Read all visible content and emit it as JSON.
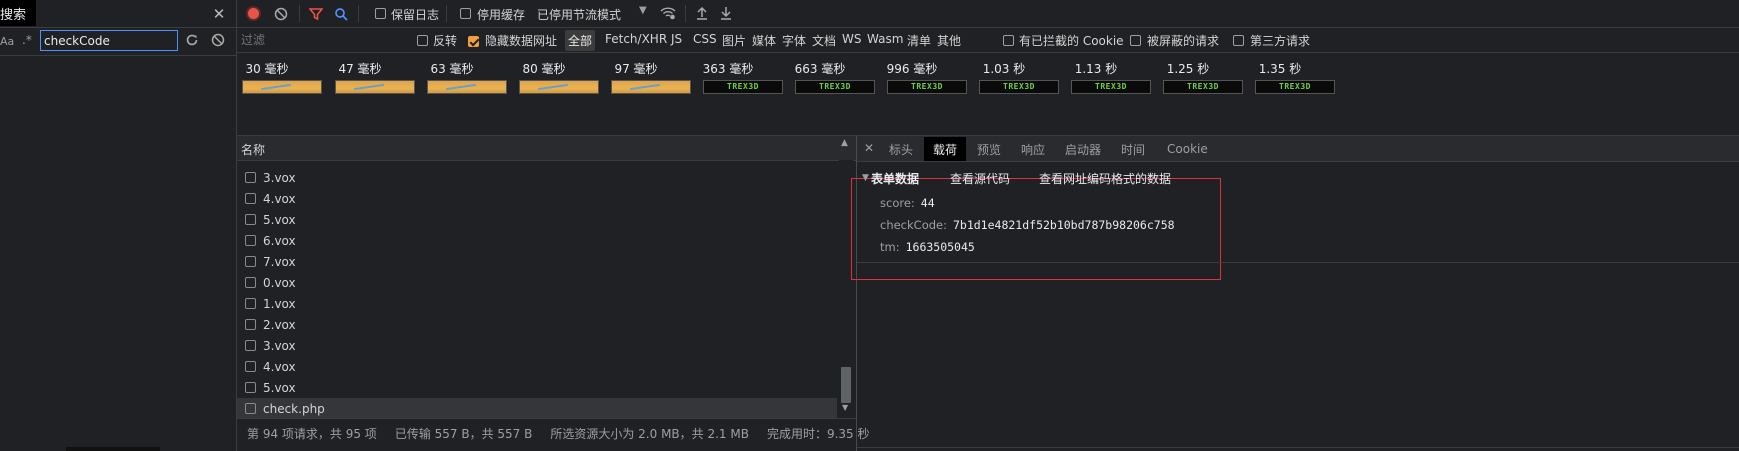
{
  "search_panel": {
    "tab_label": "搜索",
    "aa_label": "Aa",
    "regex_label": ".*",
    "search_value": "checkCode"
  },
  "toolbar": {
    "preserve_log": "保留日志",
    "disable_cache": "停用缓存",
    "throttling": "已停用节流模式"
  },
  "filter_bar": {
    "placeholder": "过滤",
    "invert": "反转",
    "hide_data_urls": "隐藏数据网址",
    "types": [
      "全部",
      "Fetch/XHR",
      "JS",
      "CSS",
      "图片",
      "媒体",
      "字体",
      "文档",
      "WS",
      "Wasm",
      "清单",
      "其他"
    ],
    "blocked_cookies": "有已拦截的 Cookie",
    "blocked_requests": "被屏蔽的请求",
    "third_party": "第三方请求"
  },
  "filmstrip": {
    "frames": [
      {
        "time": "30 毫秒",
        "kind": "y"
      },
      {
        "time": "47 毫秒",
        "kind": "y"
      },
      {
        "time": "63 毫秒",
        "kind": "y"
      },
      {
        "time": "80 毫秒",
        "kind": "y"
      },
      {
        "time": "97 毫秒",
        "kind": "y"
      },
      {
        "time": "363 毫秒",
        "kind": "g"
      },
      {
        "time": "663 毫秒",
        "kind": "g"
      },
      {
        "time": "996 毫秒",
        "kind": "g"
      },
      {
        "time": "1.03 秒",
        "kind": "g"
      },
      {
        "time": "1.13 秒",
        "kind": "g"
      },
      {
        "time": "1.25 秒",
        "kind": "g"
      },
      {
        "time": "1.35 秒",
        "kind": "g"
      }
    ],
    "frame_text": "TREX3D"
  },
  "request_list": {
    "header": "名称",
    "rows": [
      "3.vox",
      "4.vox",
      "5.vox",
      "6.vox",
      "7.vox",
      "0.vox",
      "1.vox",
      "2.vox",
      "3.vox",
      "4.vox",
      "5.vox",
      "check.php"
    ]
  },
  "status_bar": {
    "requests": "第 94 项请求，共 95 项",
    "transferred": "已传输 557 B，共 557 B",
    "resources": "所选资源大小为 2.0 MB，共 2.1 MB",
    "finish": "完成用时：9.35 秒"
  },
  "detail": {
    "tabs": [
      "标头",
      "载荷",
      "预览",
      "响应",
      "启动器",
      "时间",
      "Cookie"
    ],
    "active_tab": "载荷",
    "section_title": "表单数据",
    "view_source": "查看源代码",
    "view_url_encoded": "查看网址编码格式的数据",
    "fields": [
      {
        "key": "score:",
        "value": "44"
      },
      {
        "key": "checkCode:",
        "value": "7b1d1e4821df52b10bd787b98206c758"
      },
      {
        "key": "tm:",
        "value": "1663505045"
      }
    ]
  },
  "colors": {
    "accent": "#f29e3d",
    "highlight_box": "#e0303a",
    "record": "#e8534a"
  }
}
